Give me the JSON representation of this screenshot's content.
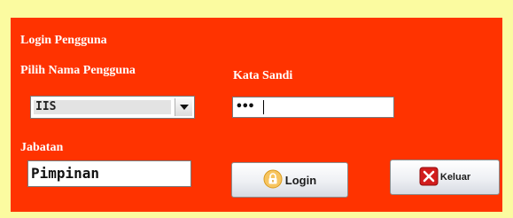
{
  "dialog": {
    "title": "Login Pengguna"
  },
  "user_select": {
    "label": "Pilih Nama Pengguna",
    "selected_value": "IIS"
  },
  "password": {
    "label": "Kata Sandi",
    "masked_value": "•••"
  },
  "role": {
    "label": "Jabatan",
    "value": "Pimpinan"
  },
  "buttons": {
    "login_label": "Login",
    "login_icon": "lock-icon",
    "exit_label": "Keluar",
    "exit_icon": "close-icon"
  },
  "colors": {
    "panel_background": "#ff3300",
    "window_border": "#fbfba0",
    "label_text": "#ffffff"
  }
}
